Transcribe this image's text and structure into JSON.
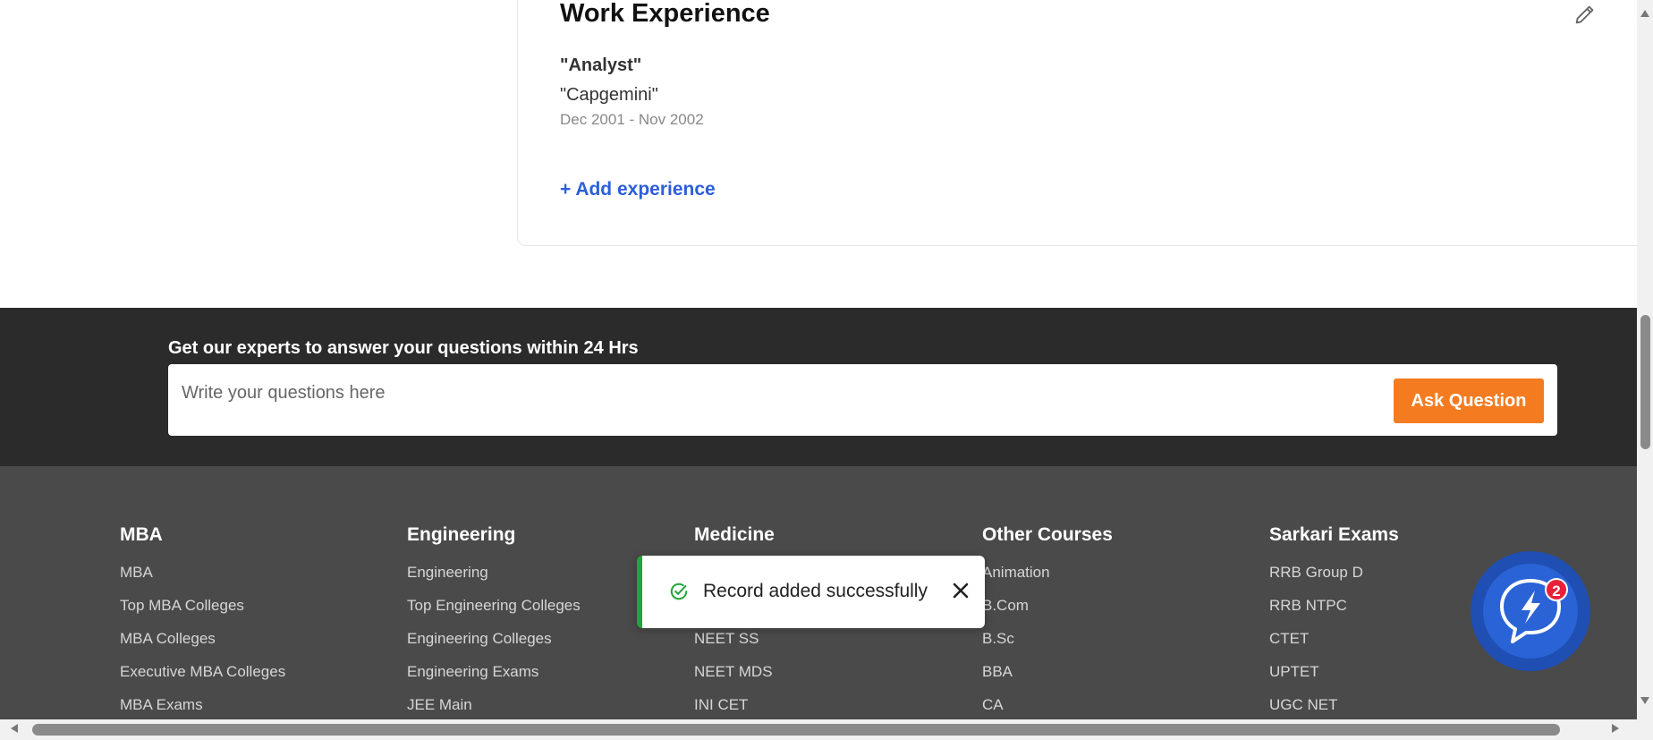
{
  "work_experience": {
    "title": "Work Experience",
    "job_title": "\"Analyst\"",
    "company": "\"Capgemini\"",
    "dates": "Dec 2001 - Nov 2002",
    "add_label": "+ Add experience"
  },
  "ask": {
    "heading": "Get our experts to answer your questions within 24 Hrs",
    "placeholder": "Write your questions here",
    "button_label": "Ask Question"
  },
  "footer": {
    "columns": [
      {
        "heading": "MBA",
        "links": [
          "MBA",
          "Top MBA Colleges",
          "MBA Colleges",
          "Executive MBA Colleges",
          "MBA Exams"
        ]
      },
      {
        "heading": "Engineering",
        "links": [
          "Engineering",
          "Top Engineering Colleges",
          "Engineering Colleges",
          "Engineering Exams",
          "JEE Main"
        ]
      },
      {
        "heading": "Medicine",
        "links": [
          "",
          "",
          "NEET SS",
          "NEET MDS",
          "INI CET"
        ]
      },
      {
        "heading": "Other Courses",
        "links": [
          "Animation",
          "B.Com",
          "B.Sc",
          "BBA",
          "CA"
        ]
      },
      {
        "heading": "Sarkari Exams",
        "links": [
          "RRB Group D",
          "RRB NTPC",
          "CTET",
          "UPTET",
          "UGC NET"
        ]
      }
    ]
  },
  "toast": {
    "message": "Record added successfully",
    "status_color": "#1fa539"
  },
  "chat": {
    "badge_count": "2",
    "icon": "lightning-chat-icon"
  },
  "colors": {
    "accent": "#f47b20",
    "link": "#2b5fd9",
    "ask_band": "#2b2b2b",
    "footer": "#4a4a4a"
  }
}
